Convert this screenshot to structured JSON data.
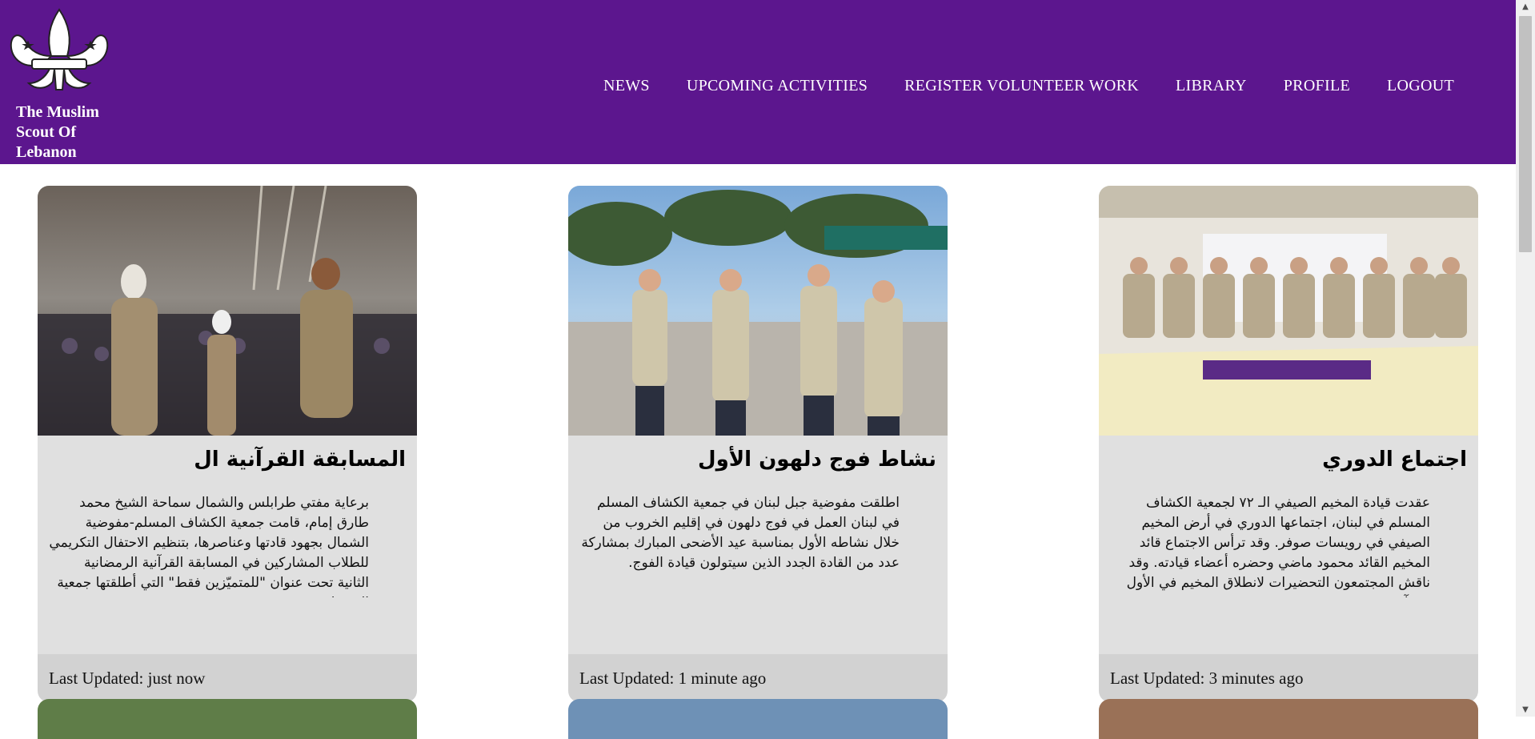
{
  "header": {
    "brand_name": "The Muslim Scout Of Lebanon",
    "nav": [
      "NEWS",
      "UPCOMING ACTIVITIES",
      "REGISTER VOLUNTEER WORK",
      "LIBRARY",
      "PROFILE",
      "LOGOUT"
    ]
  },
  "cards": [
    {
      "title": "المسابقة القرآنية ال",
      "text": "برعاية مفتي طرابلس والشمال سماحة الشيخ محمد طارق إمام، قامت جمعية الكشاف المسلم-مفوضية الشمال بجهود قادتها وعناصرها، بتنظيم الاحتفال التكريمي للطلاب المشاركين في المسابقة القرآنية الرمضانية الثانية تحت عنوان \"للمتميّزين فقط\" التي أطلقتها جمعية الرضوان تحت",
      "footer": "Last Updated: just now"
    },
    {
      "title": "نشاط فوج دلهون الأول",
      "text": "اطلقت مفوضية جبل لبنان في جمعية الكشاف المسلم في لبنان العمل في فوج دلهون في إقليم الخروب من خلال نشاطه الأول بمناسبة عيد الأضحى المبارك بمشاركة عدد من القادة الجدد الذين سيتولون قيادة الفوج.",
      "footer": "Last Updated: 1 minute ago"
    },
    {
      "title": "اجتماع الدوري",
      "text": "عقدت قيادة المخيم الصيفي الـ ٧٢ لجمعية الكشاف المسلم في لبنان، اجتماعها الدوري في أرض المخيم الصيفي في رويسات صوفر. وقد ترأس الاجتماع قائد المخيم القائد محمود ماضي وحضره أعضاء قيادته. وقد ناقش المجتمعون التحضيرات لانطلاق المخيم في الأول من آب.",
      "footer": "Last Updated: 3 minutes ago"
    }
  ],
  "colors": {
    "header_bg": "#5c168e",
    "card_bg": "#e0e0e0",
    "card_footer_bg": "#d2d2d2"
  },
  "icons": [
    "fleur-de-lis-logo",
    "scroll-up-arrow",
    "scroll-down-arrow"
  ]
}
